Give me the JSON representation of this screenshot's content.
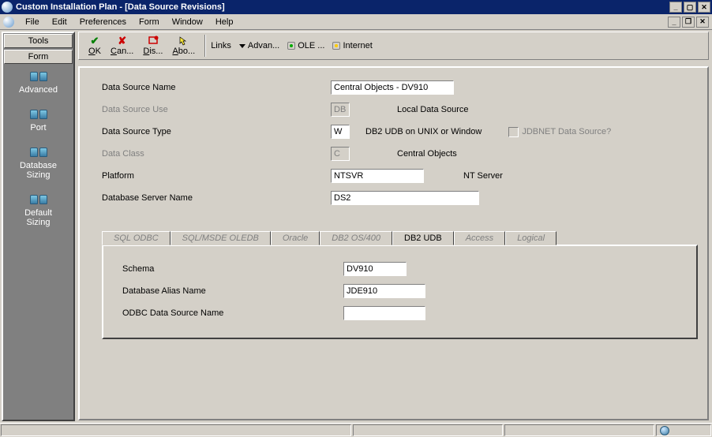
{
  "window": {
    "title": "Custom Installation Plan - [Data Source Revisions]"
  },
  "menu": {
    "file": "File",
    "edit": "Edit",
    "preferences": "Preferences",
    "form": "Form",
    "window": "Window",
    "help": "Help"
  },
  "sidebar": {
    "tabs": {
      "tools": "Tools",
      "form": "Form"
    },
    "items": [
      {
        "label": "Advanced"
      },
      {
        "label": "Port"
      },
      {
        "label": "Database\nSizing"
      },
      {
        "label": "Default\nSizing"
      }
    ]
  },
  "toolbar": {
    "ok": "OK",
    "cancel": "Can...",
    "display": "Dis...",
    "about": "Abo...",
    "links": "Links",
    "advanced": "Advan...",
    "ole": "OLE ...",
    "internet": "Internet"
  },
  "fields": {
    "ds_name": {
      "label": "Data Source Name",
      "value": "Central Objects - DV910"
    },
    "ds_use": {
      "label": "Data Source Use",
      "value": "DB",
      "after": "Local Data Source"
    },
    "ds_type": {
      "label": "Data Source Type",
      "value": "W",
      "after": "DB2 UDB on UNIX or Window",
      "checkbox": "JDBNET Data Source?"
    },
    "data_class": {
      "label": "Data Class",
      "value": "C",
      "after": "Central Objects"
    },
    "platform": {
      "label": "Platform",
      "value": "NTSVR",
      "after": "NT Server"
    },
    "db_server": {
      "label": "Database Server Name",
      "value": "DS2"
    }
  },
  "tabs": {
    "items": [
      {
        "label": "SQL ODBC"
      },
      {
        "label": "SQL/MSDE OLEDB"
      },
      {
        "label": "Oracle"
      },
      {
        "label": "DB2 OS/400"
      },
      {
        "label": "DB2 UDB"
      },
      {
        "label": "Access"
      },
      {
        "label": "Logical"
      }
    ],
    "active": 4,
    "pane": {
      "schema": {
        "label": "Schema",
        "value": "DV910"
      },
      "alias": {
        "label": "Database Alias Name",
        "value": "JDE910"
      },
      "odbc": {
        "label": "ODBC Data Source Name",
        "value": ""
      }
    }
  }
}
